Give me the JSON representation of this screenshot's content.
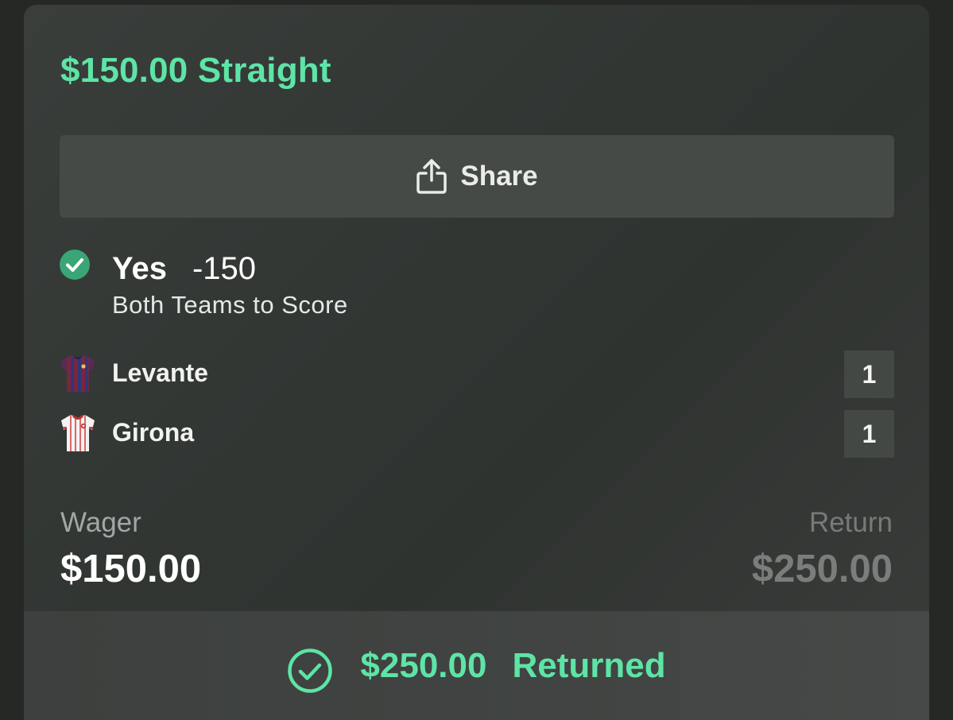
{
  "bet": {
    "title": "$150.00 Straight",
    "share_label": "Share",
    "pick": {
      "name": "Yes",
      "odds": "-150",
      "market": "Both Teams to Score"
    },
    "teams": [
      {
        "name": "Levante",
        "score": "1",
        "jersey_icon": "levante-jersey-icon"
      },
      {
        "name": "Girona",
        "score": "1",
        "jersey_icon": "girona-jersey-icon"
      }
    ],
    "wager": {
      "label": "Wager",
      "value": "$150.00"
    },
    "return": {
      "label": "Return",
      "value": "$250.00"
    },
    "result": {
      "amount": "$250.00",
      "status": "Returned"
    }
  },
  "colors": {
    "accent_green": "#5ee4a6",
    "check_green": "#3aa576",
    "card_bg": "#333735",
    "button_bg": "#464a47"
  }
}
